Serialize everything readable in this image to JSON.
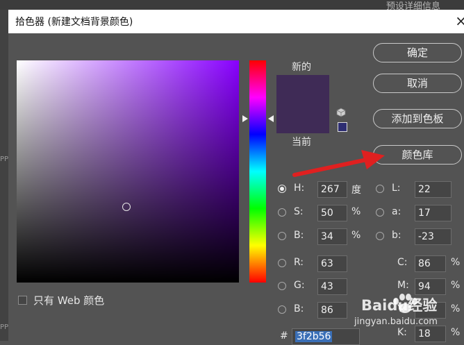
{
  "background": {
    "partial_text": "预设详细信息",
    "left_partial_1": "PP",
    "left_partial_2": "PP"
  },
  "title": "拾色器 (新建文档背景颜色)",
  "labels": {
    "new": "新的",
    "current": "当前",
    "web_only": "只有 Web 颜色"
  },
  "buttons": {
    "ok": "确定",
    "cancel": "取消",
    "add_swatch": "添加到色板",
    "libraries": "颜色库"
  },
  "hsb": [
    {
      "label": "H:",
      "value": "267",
      "unit": "度",
      "selected": true
    },
    {
      "label": "S:",
      "value": "50",
      "unit": "%",
      "selected": false
    },
    {
      "label": "B:",
      "value": "34",
      "unit": "%",
      "selected": false
    }
  ],
  "rgb": [
    {
      "label": "R:",
      "value": "63"
    },
    {
      "label": "G:",
      "value": "43"
    },
    {
      "label": "B:",
      "value": "86"
    }
  ],
  "lab": [
    {
      "label": "L:",
      "value": "22"
    },
    {
      "label": "a:",
      "value": "17"
    },
    {
      "label": "b:",
      "value": "-23"
    }
  ],
  "cmyk": [
    {
      "label": "C:",
      "value": "86",
      "unit": "%"
    },
    {
      "label": "M:",
      "value": "94",
      "unit": "%"
    },
    {
      "label": "Y:",
      "value": "",
      "unit": "%"
    },
    {
      "label": "K:",
      "value": "18",
      "unit": "%"
    }
  ],
  "hex": {
    "label": "#",
    "value": "3f2b56"
  },
  "watermark": {
    "brand": "Baidu经验",
    "url": "jingyan.baidu.com"
  },
  "colors": {
    "selected": "#3f2b56",
    "arrow": "#e02020",
    "hex_highlight": "#3a6fb7"
  },
  "icons": [
    "close-icon",
    "cube-icon",
    "websafe-swatch-icon",
    "red-arrow-icon",
    "baidu-paw-icon"
  ]
}
